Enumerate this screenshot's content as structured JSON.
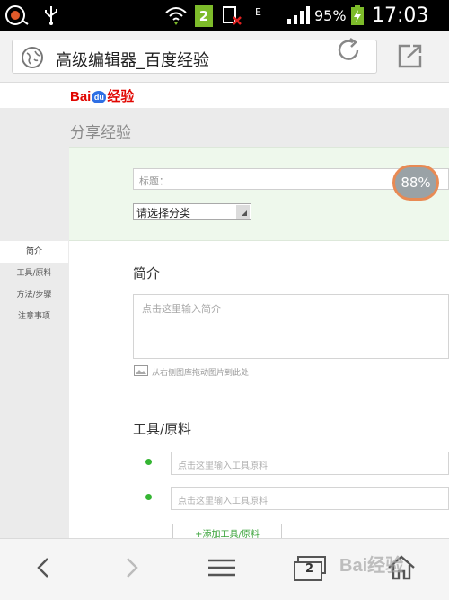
{
  "status_bar": {
    "sim_badge": "2",
    "network_type": "E",
    "battery_percent": "95%",
    "time": "17:03"
  },
  "address_bar": {
    "url_title": "高级编辑器_百度经验"
  },
  "header": {
    "logo_bai": "Bai",
    "logo_du": "du",
    "logo_jingyan": "经验"
  },
  "page": {
    "heading": "分享经验",
    "title_placeholder": "标题：",
    "progress": "88%",
    "category_select": "请选择分类"
  },
  "left_nav": {
    "items": [
      "简介",
      "工具/原料",
      "方法/步骤",
      "注意事项"
    ]
  },
  "intro": {
    "title": "简介",
    "placeholder": "点击这里输入简介",
    "drag_hint": "从右侧图库拖动图片到此处"
  },
  "tools": {
    "title": "工具/原料",
    "row1_placeholder": "点击这里输入工具原料",
    "row2_placeholder": "点击这里输入工具原料",
    "add_button": "+添加工具/原料"
  },
  "bottom_bar": {
    "tab_count": "2"
  },
  "watermark": "Bai经验"
}
